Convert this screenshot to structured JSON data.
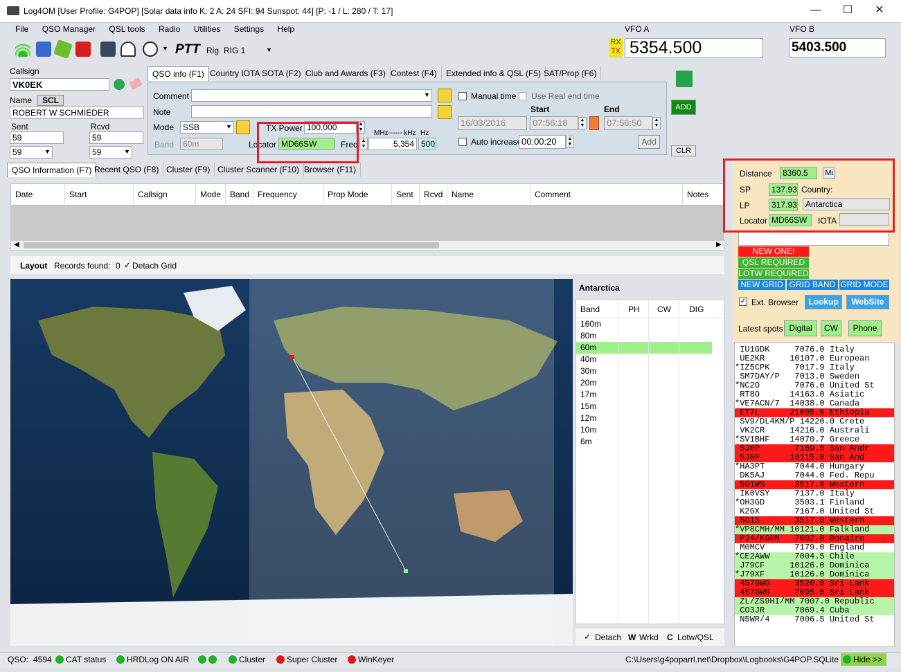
{
  "window": {
    "title": "Log4OM [User Profile: G4POP] [Solar data info K: 2 A: 24 SFI: 94 Sunspot: 44] [P: -1 / L: 280 / T: 17]",
    "controls": [
      "—",
      "☐",
      "✕"
    ]
  },
  "menu": [
    "File",
    "QSO Manager",
    "QSL tools",
    "Radio",
    "Utilities",
    "Settings",
    "Help"
  ],
  "toolbar": {
    "ptt": "PTT",
    "rig_label": "Rig",
    "rig_value": "RIG 1"
  },
  "vfo": {
    "a_label": "VFO A",
    "a_value": "5354.500",
    "b_label": "VFO B",
    "b_value": "5403.500",
    "rx": "RX",
    "tx": "TX"
  },
  "callsign_panel": {
    "callsign_label": "Callsign",
    "callsign": "VK0EK",
    "name_label": "Name",
    "scl": "SCL",
    "name": "ROBERT W SCHMIEDER",
    "sent_label": "Sent",
    "rcvd_label": "Rcvd",
    "sent": "59",
    "rcvd": "59",
    "sent_drop": "59",
    "rcvd_drop": "59"
  },
  "qso_tabs": [
    "QSO info (F1)",
    "Country IOTA SOTA (F2)",
    "Club and Awards (F3)",
    "Contest (F4)",
    "Extended info & QSL (F5)",
    "SAT/Prop (F6)"
  ],
  "qso_info": {
    "comment_label": "Comment",
    "note_label": "Note",
    "mode_label": "Mode",
    "mode": "SSB",
    "band_label": "Band",
    "band": "60m",
    "txpower_label": "TX Power",
    "txpower": "100.000",
    "locator_label": "Locator",
    "locator": "MD66SW",
    "freq_label": "Freq",
    "freq_units": "MHz------ kHz",
    "hz_label": "Hz",
    "freq": "5,354",
    "hz": "500",
    "manual_time": "Manual time",
    "real_end_time": "Use Real end time",
    "start_label": "Start",
    "end_label": "End",
    "date": "16/03/2016",
    "start": "07:56:18",
    "end": "07:56:50",
    "auto_increase": "Auto increase",
    "auto_value": "00:00:20",
    "add_small": "Add",
    "add": "ADD",
    "clr": "CLR"
  },
  "lower_tabs": [
    "QSO Information (F7)",
    "Recent QSO (F8)",
    "Cluster (F9)",
    "Cluster Scanner (F10)",
    "Browser (F11)"
  ],
  "grid": {
    "columns": [
      "Date",
      "Start",
      "Callsign",
      "Mode",
      "Band",
      "Frequency",
      "Prop Mode",
      "Sent",
      "Rcvd",
      "Name",
      "Comment",
      "Notes"
    ]
  },
  "layout_bar": {
    "layout": "Layout",
    "records": "Records found:",
    "count": "0",
    "detach": "Detach Grid"
  },
  "band_panel": {
    "country": "Antarctica",
    "headers": [
      "Band",
      "PH",
      "CW",
      "DIG"
    ],
    "bands": [
      "160m",
      "80m",
      "60m",
      "40m",
      "30m",
      "20m",
      "17m",
      "15m",
      "12m",
      "10m",
      "6m"
    ],
    "highlighted": "60m",
    "footer": {
      "detach": "Detach",
      "w": "W",
      "wrkd": "Wrkd",
      "c": "C",
      "lotw": "Lotw/QSL"
    }
  },
  "info_panel": {
    "distance_label": "Distance",
    "distance": "8360.5",
    "unit": "Mi",
    "sp_label": "SP",
    "sp": "137.93",
    "country_label": "Country:",
    "lp_label": "LP",
    "lp": "317.93",
    "country": "Antarctica",
    "locator_label": "Locator",
    "locator": "MD66SW",
    "iota_label": "IOTA",
    "iota": ""
  },
  "status_badges": {
    "new_one": "NEW ONE!",
    "qsl_required": "QSL REQUIRED",
    "lotw_required": "LOTW REQUIRED",
    "new_grid": "NEW GRID",
    "grid_band": "GRID BAND",
    "grid_mode": "GRID MODE"
  },
  "browser": {
    "ext_browser": "Ext. Browser",
    "lookup": "Lookup",
    "website": "WebSite"
  },
  "latest_spots": {
    "label": "Latest spots",
    "digital": "Digital",
    "cw": "CW",
    "phone": "Phone"
  },
  "spots": [
    {
      "text": " IU1GDK     7076.0 Italy",
      "color": "#ffffff"
    },
    {
      "text": " UE2KR     10107.0 European",
      "color": "#ffffff"
    },
    {
      "text": "*IZ5CPK     7017.9 Italy",
      "color": "#ffffff"
    },
    {
      "text": " SM7DAY/P   7013.0 Sweden",
      "color": "#ffffff"
    },
    {
      "text": "*NC2O       7076.0 United St",
      "color": "#ffffff"
    },
    {
      "text": " RT8O      14163.0 Asiatic",
      "color": "#ffffff"
    },
    {
      "text": "*VE7ACN/7  14038.0 Canada",
      "color": "#ffffff"
    },
    {
      "text": " ET7L      21005.0 Ethiopia",
      "color": "#ff1a1a"
    },
    {
      "text": " SV9/DL4KM/P 14220.0 Crete",
      "color": "#ffffff"
    },
    {
      "text": " VK2CR     14216.0 Australi",
      "color": "#ffffff"
    },
    {
      "text": "*SV1BHF    14070.7 Greece",
      "color": "#ffffff"
    },
    {
      "text": " 5J0P       7169.5 San Andr",
      "color": "#ff1a1a"
    },
    {
      "text": " 5J0P      10115.0 San And",
      "color": "#ff1a1a"
    },
    {
      "text": "*HA3PT      7044.0 Hungary",
      "color": "#ffffff"
    },
    {
      "text": " DK5AJ      7044.0 Fed. Repu",
      "color": "#ffffff"
    },
    {
      "text": " 5O1WS      3517.0 Western",
      "color": "#ff1a1a"
    },
    {
      "text": " IK0VSY     7137.0 Italy",
      "color": "#ffffff"
    },
    {
      "text": "*OH3GD      3503.1 Finland",
      "color": "#ffffff"
    },
    {
      "text": " K2GX       7167.0 United St",
      "color": "#ffffff"
    },
    {
      "text": " 5O1S       3517.0 Western",
      "color": "#ff1a1a"
    },
    {
      "text": "*VP8CMH/MM 10121.0 Falkland",
      "color": "#b6f5a8"
    },
    {
      "text": " PJ4/KG9N   7002.0 Bonaire",
      "color": "#ff1a1a"
    },
    {
      "text": " M0MCV      7179.0 England",
      "color": "#ffffff"
    },
    {
      "text": "*CE2AWW     7004.5 Chile",
      "color": "#b6f5a8"
    },
    {
      "text": " J79CF     10126.0 Dominica",
      "color": "#b6f5a8"
    },
    {
      "text": "*J79XF     10126.0 Dominica",
      "color": "#b6f5a8"
    },
    {
      "text": " 4S7GWG     3526.0 Sri Lank",
      "color": "#ff1a1a"
    },
    {
      "text": " 4S7GWG     7095.0 Sri Lank",
      "color": "#ff1a1a"
    },
    {
      "text": " ZL/ZS9HI/MM 7007.0 Republic",
      "color": "#b6f5a8"
    },
    {
      "text": " CO3JR      7069.4 Cuba",
      "color": "#b6f5a8"
    },
    {
      "text": " N5WR/4     7006.5 United St",
      "color": "#ffffff"
    }
  ],
  "statusbar": {
    "qso_label": "QSO:",
    "qso_count": "4594",
    "cat": "CAT status",
    "hrdlog": "HRDLog ON AIR",
    "cluster": "Cluster",
    "super_cluster": "Super Cluster",
    "winkeyer": "WinKeyer",
    "path": "C:\\Users\\g4poparrl.net\\Dropbox\\Logbooks\\G4POP.SQLite",
    "hide": "Hide >>"
  }
}
